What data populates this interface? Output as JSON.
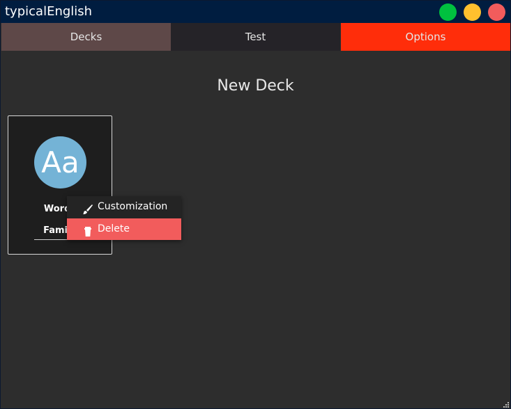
{
  "window": {
    "title": "typicalEnglish",
    "controls": {
      "maximize_color": "#00c13f",
      "minimize_color": "#ffc02e",
      "close_color": "#f25c5c"
    }
  },
  "tabs": [
    {
      "label": "Decks",
      "color": "#5e4848"
    },
    {
      "label": "Test",
      "color": "#252328"
    },
    {
      "label": "Options",
      "color": "#ff2d0a"
    }
  ],
  "main": {
    "heading": "New Deck"
  },
  "deck": {
    "avatar_text": "Aa",
    "name": "Words",
    "category": "Family"
  },
  "context_menu": {
    "items": [
      {
        "label": "Customization",
        "icon": "brush-icon"
      },
      {
        "label": "Delete",
        "icon": "trash-icon",
        "highlight_color": "#f25c5c"
      }
    ]
  }
}
